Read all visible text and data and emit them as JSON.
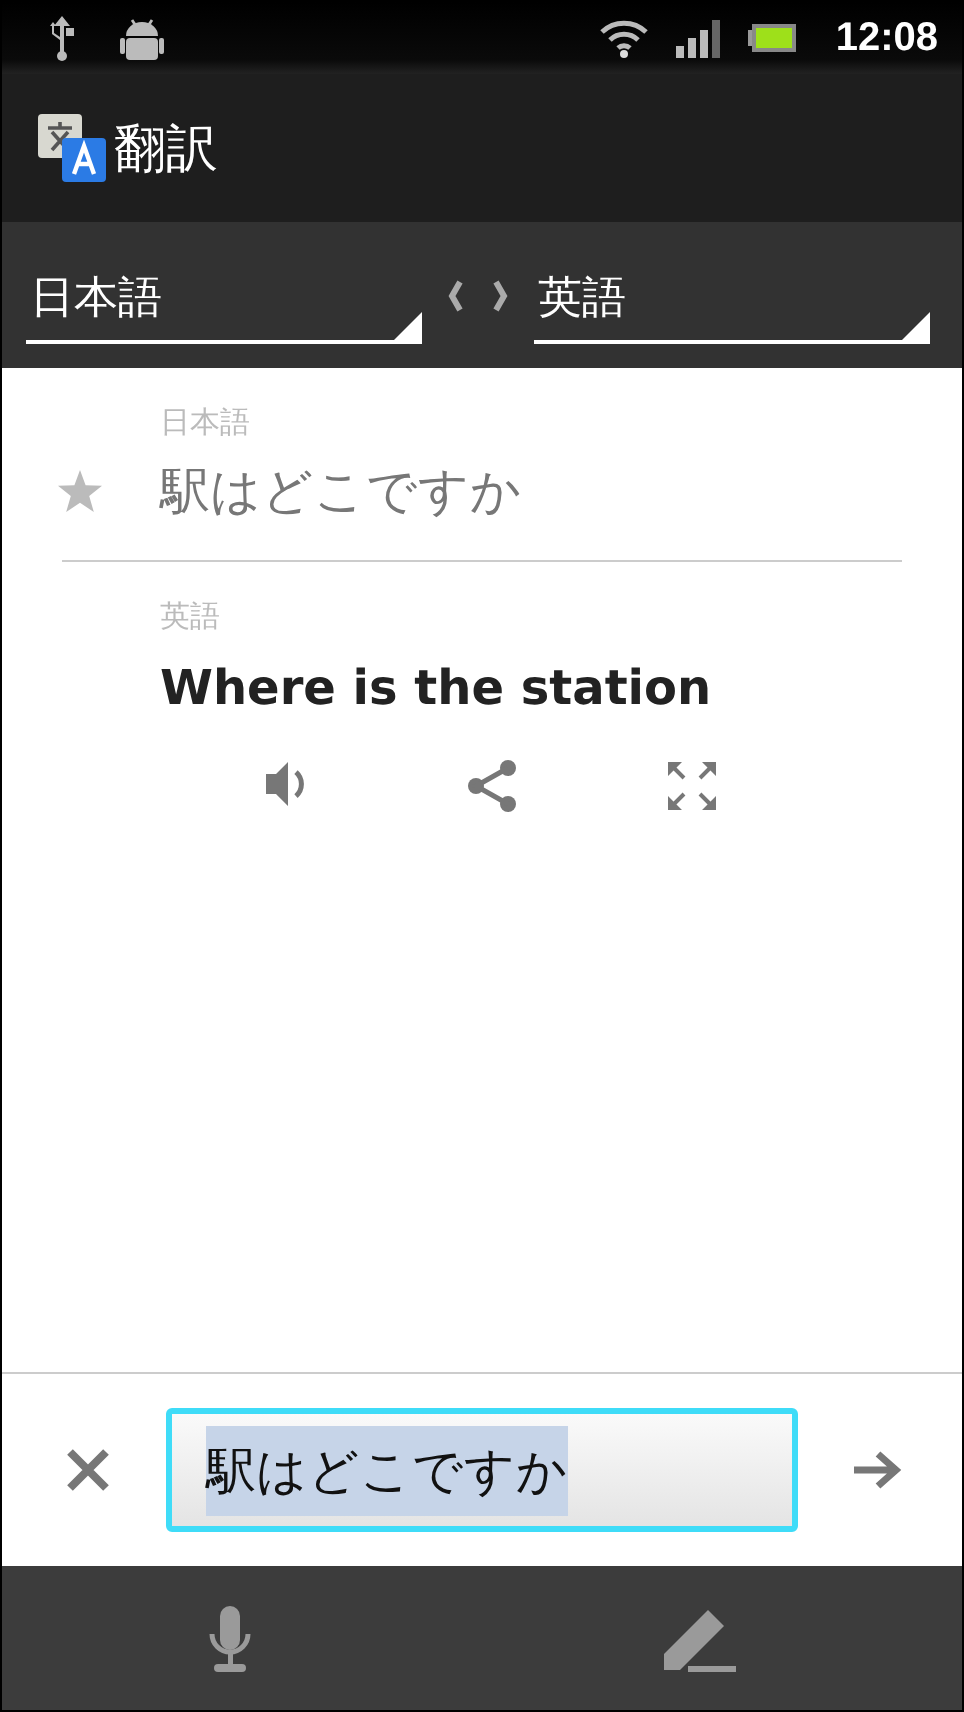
{
  "status_bar": {
    "time": "12:08"
  },
  "app_bar": {
    "title": "翻訳"
  },
  "language_bar": {
    "source": "日本語",
    "target": "英語"
  },
  "result": {
    "source_label": "日本語",
    "source_text": "駅はどこですか",
    "starred": false,
    "target_label": "英語",
    "target_text": "Where is the station"
  },
  "input": {
    "value": "駅はどこですか",
    "focused": true,
    "text_selected": true
  }
}
